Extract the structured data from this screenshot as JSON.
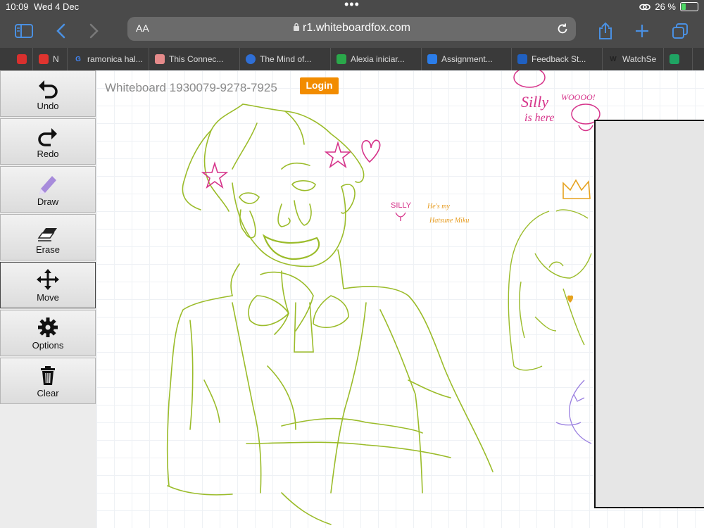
{
  "status": {
    "time": "10:09",
    "date": "Wed 4 Dec",
    "battery": "26 %",
    "battery_level": 0.26
  },
  "browser": {
    "address_aa": "AA",
    "url": "r1.whiteboardfox.com",
    "tabs": [
      {
        "label": "",
        "color": "#d9302e"
      },
      {
        "label": "N",
        "color": "#e0342f"
      },
      {
        "label": "ramonica hal...",
        "color": "#ffffff"
      },
      {
        "label": "This Connec...",
        "color": "#e58a8a"
      },
      {
        "label": "The Mind of...",
        "color": "#2f6fd6"
      },
      {
        "label": "Alexia iniciar...",
        "color": "#2aa84a"
      },
      {
        "label": "Assignment...",
        "color": "#2b7de9"
      },
      {
        "label": "Feedback St...",
        "color": "#2060c0"
      },
      {
        "label": "WatchSe",
        "color": "#ffffff"
      },
      {
        "label": "",
        "color": "#1fa463"
      }
    ]
  },
  "tools": [
    {
      "name": "undo",
      "label": "Undo"
    },
    {
      "name": "redo",
      "label": "Redo"
    },
    {
      "name": "draw",
      "label": "Draw"
    },
    {
      "name": "erase",
      "label": "Erase"
    },
    {
      "name": "move",
      "label": "Move"
    },
    {
      "name": "options",
      "label": "Options"
    },
    {
      "name": "clear",
      "label": "Clear"
    }
  ],
  "whiteboard": {
    "title": "Whiteboard 1930079-9278-7925",
    "login": "Login",
    "doodle_texts": {
      "silly_here_1": "Silly",
      "silly_here_2": "is here",
      "woooo": "WOOOO!",
      "silly": "SILLY",
      "miku_1": "He's my",
      "miku_2": "Hatsune Miku"
    }
  },
  "colors": {
    "toolbar": "#4a4a4a",
    "accent": "#4a90e2",
    "login": "#f28c00",
    "sketch_green": "#9bbc2a",
    "pink": "#d6338a"
  }
}
